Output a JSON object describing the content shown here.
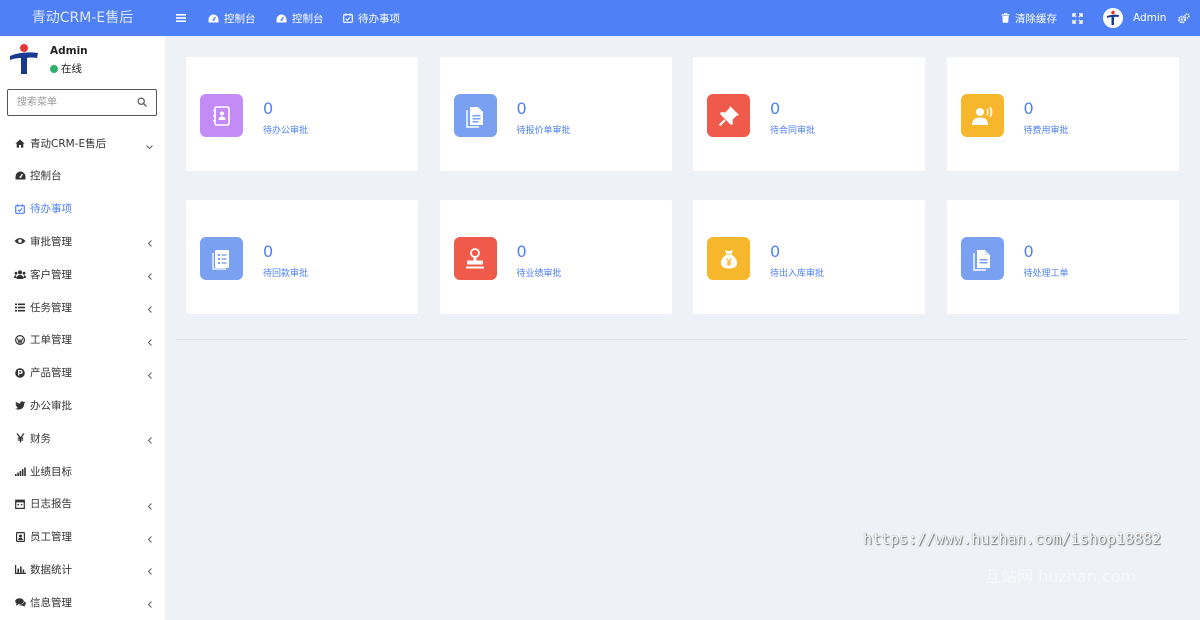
{
  "brand": "青动CRM-E售后",
  "topnav": {
    "items": [
      {
        "label": "控制台",
        "icon": "dashboard-icon"
      },
      {
        "label": "控制台",
        "icon": "dashboard-icon"
      },
      {
        "label": "待办事项",
        "icon": "calendar-check-icon"
      }
    ],
    "clear_cache": "清除缓存",
    "user": "Admin"
  },
  "sidebar": {
    "user": {
      "name": "Admin",
      "status": "在线"
    },
    "search_placeholder": "搜索菜单",
    "items": [
      {
        "label": "青动CRM-E售后",
        "icon": "home-icon",
        "arrow": "down",
        "active": false
      },
      {
        "label": "控制台",
        "icon": "dashboard-icon",
        "arrow": "",
        "active": false
      },
      {
        "label": "待办事项",
        "icon": "calendar-check-icon",
        "arrow": "",
        "active": true
      },
      {
        "label": "审批管理",
        "icon": "eye-icon",
        "arrow": "left",
        "active": false
      },
      {
        "label": "客户管理",
        "icon": "users-icon",
        "arrow": "left",
        "active": false
      },
      {
        "label": "任务管理",
        "icon": "list-icon",
        "arrow": "left",
        "active": false
      },
      {
        "label": "工单管理",
        "icon": "wordpress-icon",
        "arrow": "left",
        "active": false
      },
      {
        "label": "产品管理",
        "icon": "product-p-icon",
        "arrow": "left",
        "active": false
      },
      {
        "label": "办公审批",
        "icon": "bird-icon",
        "arrow": "",
        "active": false
      },
      {
        "label": "财务",
        "icon": "yen-icon",
        "arrow": "left",
        "active": false
      },
      {
        "label": "业绩目标",
        "icon": "signal-icon",
        "arrow": "",
        "active": false
      },
      {
        "label": "日志报告",
        "icon": "calendar-icon",
        "arrow": "left",
        "active": false
      },
      {
        "label": "员工管理",
        "icon": "id-badge-icon",
        "arrow": "left",
        "active": false
      },
      {
        "label": "数据统计",
        "icon": "bar-chart-icon",
        "arrow": "left",
        "active": false
      },
      {
        "label": "信息管理",
        "icon": "comments-icon",
        "arrow": "left",
        "active": false
      }
    ]
  },
  "cards": [
    {
      "value": "0",
      "label": "待办公审批",
      "icon": "office-doc-icon",
      "color": "#c38bf5"
    },
    {
      "value": "0",
      "label": "待报价单审批",
      "icon": "quote-doc-icon",
      "color": "#7aa0f2"
    },
    {
      "value": "0",
      "label": "待合同审批",
      "icon": "pin-icon",
      "color": "#ef5a4a"
    },
    {
      "value": "0",
      "label": "待费用审批",
      "icon": "person-speaker-icon",
      "color": "#f6b72c"
    },
    {
      "value": "0",
      "label": "待回款审批",
      "icon": "checklist-icon",
      "color": "#7aa0f2"
    },
    {
      "value": "0",
      "label": "待业绩审批",
      "icon": "stamp-icon",
      "color": "#ef5a4a"
    },
    {
      "value": "0",
      "label": "待出入库审批",
      "icon": "money-bag-icon",
      "color": "#f6b72c"
    },
    {
      "value": "0",
      "label": "待处理工单",
      "icon": "document-icon",
      "color": "#7aa0f2"
    }
  ],
  "watermark": "https://www.huzhan.com/ishop18882",
  "watermark_logo": "互站网 huzhan.com"
}
